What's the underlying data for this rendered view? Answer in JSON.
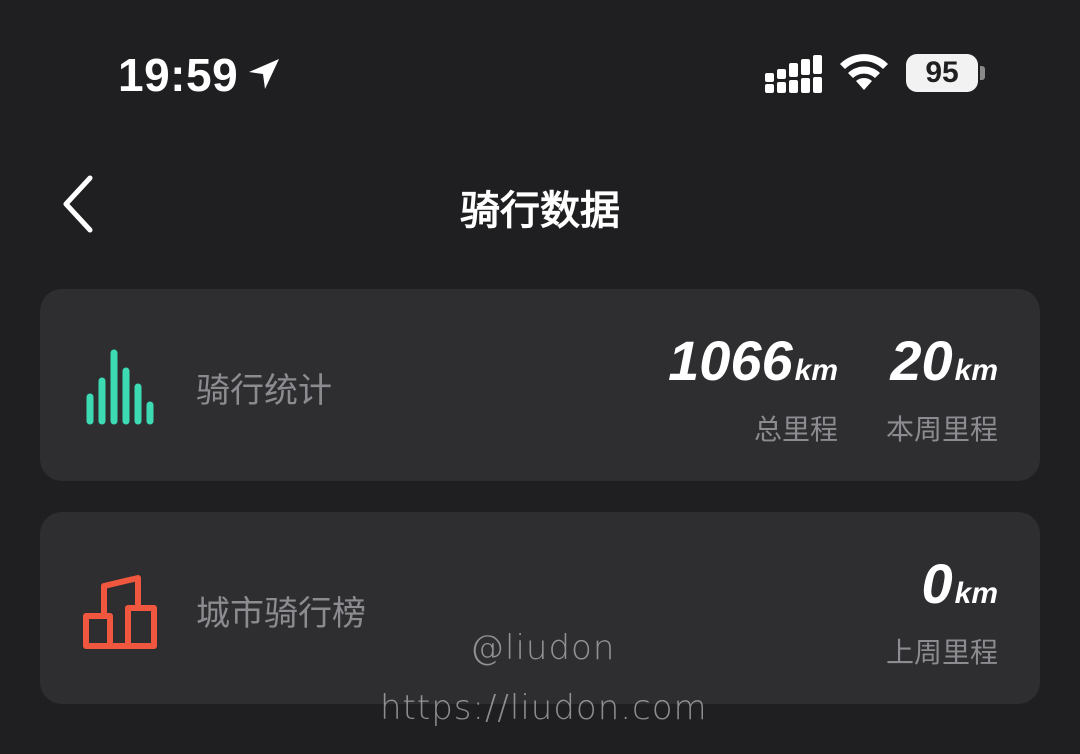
{
  "status_bar": {
    "time": "19:59",
    "battery": "95",
    "icons": [
      "location-arrow-icon",
      "signal-icon",
      "wifi-icon",
      "battery-icon"
    ]
  },
  "header": {
    "title": "骑行数据",
    "back_icon": "chevron-left-icon"
  },
  "cards": {
    "stats": {
      "label": "骑行统计",
      "icon": "bar-chart-icon",
      "icon_color": "#3ddbb4",
      "total": {
        "value": "1066",
        "unit": "km",
        "caption": "总里程"
      },
      "week": {
        "value": "20",
        "unit": "km",
        "caption": "本周里程"
      }
    },
    "ranking": {
      "label": "城市骑行榜",
      "icon": "city-podium-icon",
      "icon_color": "#f0573e",
      "last_week": {
        "value": "0",
        "unit": "km",
        "caption": "上周里程"
      }
    }
  },
  "watermark": {
    "handle": "@liudon",
    "url": "https://liudon.com"
  }
}
